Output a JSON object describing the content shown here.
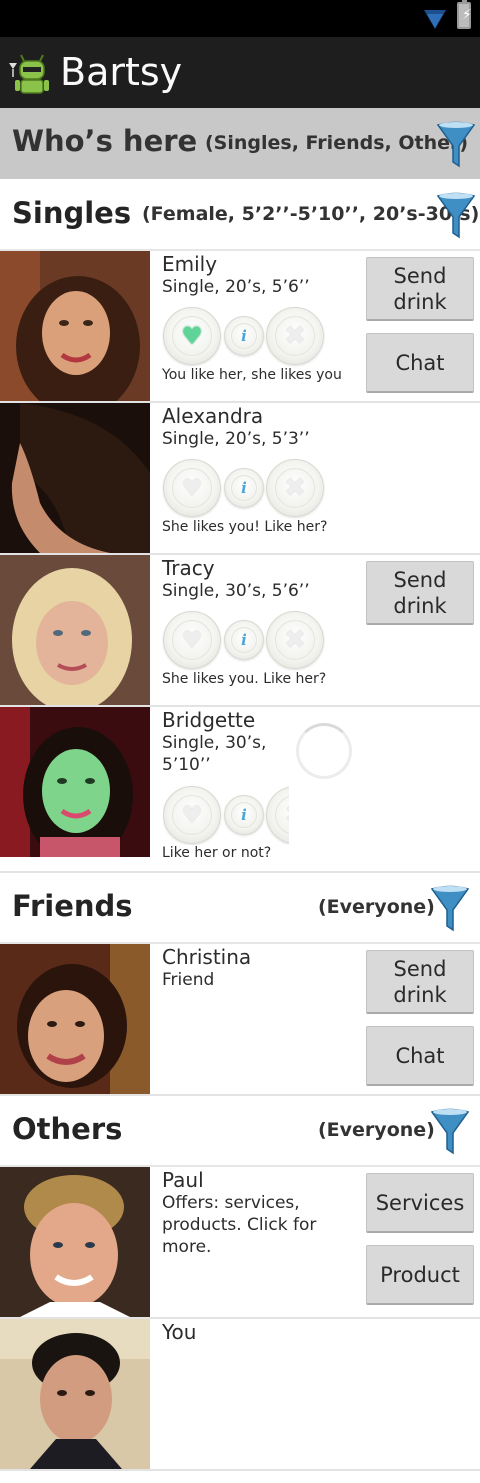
{
  "app": {
    "title": "Bartsy"
  },
  "colors": {
    "accent_funnel": "#3f8fc4",
    "like_green": "#5fd496",
    "section_header_bg": "#c8c8c8"
  },
  "who_header": {
    "title": "Who’s here",
    "filter": "(Singles, Friends, Other)",
    "icon": "funnel-icon"
  },
  "singles": {
    "title": "Singles",
    "filter": "(Female, 5’2’’-5’10’’, 20’s-30’s)",
    "people": [
      {
        "name": "Emily",
        "desc": "Single, 20’s, 5’6’’",
        "status": "You like her, she likes you",
        "liked": true,
        "buttons": [
          "Send drink",
          "Chat"
        ]
      },
      {
        "name": "Alexandra",
        "desc": "Single, 20’s, 5’3’’",
        "status": "She likes you! Like her?",
        "liked": false,
        "buttons": []
      },
      {
        "name": "Tracy",
        "desc": "Single, 30’s, 5’6’’",
        "status": "She likes you. Like her?",
        "liked": false,
        "buttons": [
          "Send drink"
        ]
      },
      {
        "name": "Bridgette",
        "desc": "Single, 30’s, 5’10’’",
        "status": "Like her or not?",
        "liked": false,
        "buttons": []
      }
    ]
  },
  "friends": {
    "title": "Friends",
    "filter": "(Everyone)",
    "people": [
      {
        "name": "Christina",
        "desc": "Friend",
        "buttons": [
          "Send drink",
          "Chat"
        ]
      }
    ]
  },
  "others": {
    "title": "Others",
    "filter": "(Everyone)",
    "people": [
      {
        "name": "Paul",
        "desc": "Offers: services, products. Click for more.",
        "buttons": [
          "Services",
          "Product"
        ]
      },
      {
        "name": "You",
        "desc": ""
      }
    ]
  }
}
